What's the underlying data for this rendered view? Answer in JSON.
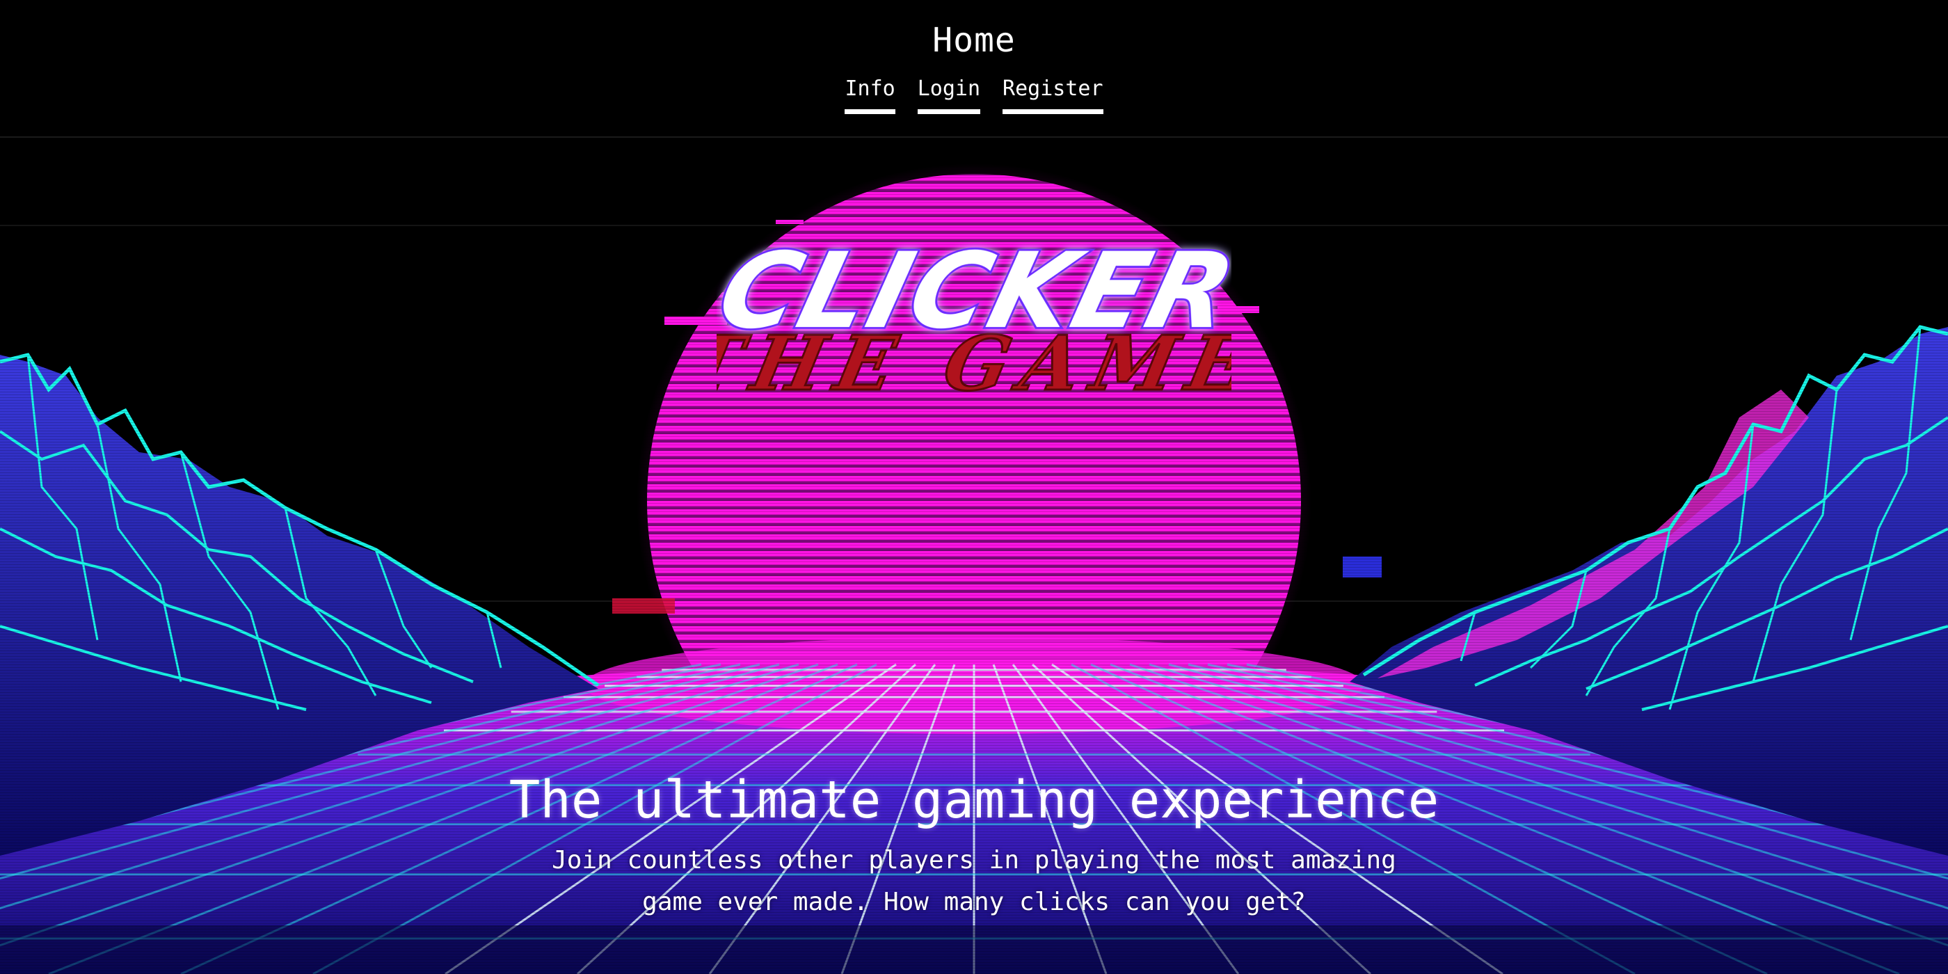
{
  "header": {
    "title": "Home",
    "nav": [
      {
        "label": "Info"
      },
      {
        "label": "Login"
      },
      {
        "label": "Register"
      }
    ]
  },
  "logo": {
    "line1": "CLICKER",
    "line2": "THE GAME"
  },
  "hero": {
    "title": "The ultimate gaming experience",
    "subtitle": "Join countless other players in playing the most amazing game ever made. How many clicks can you get?"
  },
  "colors": {
    "background": "#000000",
    "sun": "#ff13e0",
    "grid_cyan": "#19f5e8",
    "grid_blue": "#2d2bd9",
    "logo_red": "#c0121b",
    "text": "#ffffff"
  },
  "icons": {
    "background": "synthwave-sun-grid-illustration"
  }
}
